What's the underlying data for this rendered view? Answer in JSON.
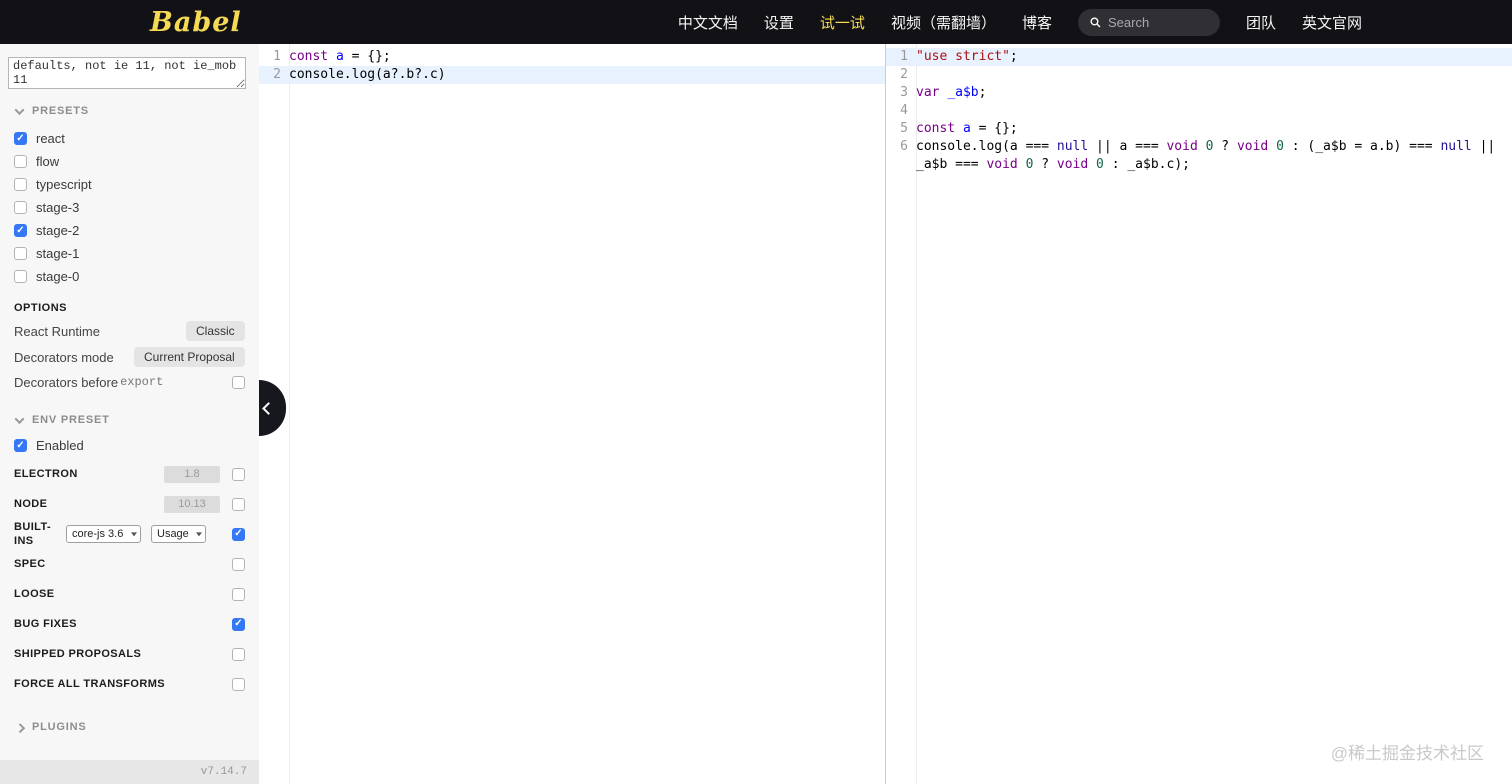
{
  "header": {
    "logo": "Babel",
    "nav": [
      {
        "label": "中文文档",
        "active": false
      },
      {
        "label": "设置",
        "active": false
      },
      {
        "label": "试一试",
        "active": true
      },
      {
        "label": "视频（需翻墙）",
        "active": false
      },
      {
        "label": "博客",
        "active": false
      }
    ],
    "search": {
      "placeholder": "Search"
    },
    "nav_right": [
      {
        "label": "团队"
      },
      {
        "label": "英文官网"
      }
    ]
  },
  "sidebar": {
    "browserslist_value": "defaults, not ie 11, not ie_mob 11",
    "presets": {
      "title": "PRESETS",
      "items": [
        {
          "label": "react",
          "checked": true
        },
        {
          "label": "flow",
          "checked": false
        },
        {
          "label": "typescript",
          "checked": false
        },
        {
          "label": "stage-3",
          "checked": false
        },
        {
          "label": "stage-2",
          "checked": true
        },
        {
          "label": "stage-1",
          "checked": false
        },
        {
          "label": "stage-0",
          "checked": false
        }
      ]
    },
    "options": {
      "title": "OPTIONS",
      "react_runtime_label": "React Runtime",
      "react_runtime_value": "Classic",
      "decorators_mode_label": "Decorators mode",
      "decorators_mode_value": "Current Proposal",
      "decorators_before_label": "Decorators before",
      "decorators_before_code": "export",
      "decorators_before_checked": false
    },
    "env": {
      "title": "ENV PRESET",
      "enabled_label": "Enabled",
      "enabled_checked": true,
      "electron_label": "ELECTRON",
      "electron_value": "1.8",
      "electron_checked": false,
      "node_label": "NODE",
      "node_value": "10.13",
      "node_checked": false,
      "builtins_label": "BUILT-INS",
      "builtins_select1": "core-js 3.6",
      "builtins_select2": "Usage",
      "builtins_checked": true,
      "toggles": [
        {
          "label": "SPEC",
          "checked": false
        },
        {
          "label": "LOOSE",
          "checked": false
        },
        {
          "label": "BUG FIXES",
          "checked": true
        },
        {
          "label": "SHIPPED PROPOSALS",
          "checked": false
        },
        {
          "label": "FORCE ALL TRANSFORMS",
          "checked": false
        }
      ]
    },
    "plugins_title": "PLUGINS",
    "version": "v7.14.7"
  },
  "editor_in": {
    "lines": [
      {
        "num": "1",
        "active": false,
        "tokens": [
          {
            "t": "const",
            "c": "keyword"
          },
          {
            "t": " "
          },
          {
            "t": "a",
            "c": "def"
          },
          {
            "t": " = {};"
          }
        ]
      },
      {
        "num": "2",
        "active": true,
        "tokens": [
          {
            "t": "console",
            "c": "variable"
          },
          {
            "t": ".log(a?.b?.c)"
          }
        ]
      }
    ]
  },
  "editor_out": {
    "lines": [
      {
        "num": "1",
        "active": true,
        "tokens": [
          {
            "t": "\"use strict\"",
            "c": "string"
          },
          {
            "t": ";"
          }
        ]
      },
      {
        "num": "2",
        "active": false,
        "tokens": []
      },
      {
        "num": "3",
        "active": false,
        "tokens": [
          {
            "t": "var",
            "c": "keyword"
          },
          {
            "t": " "
          },
          {
            "t": "_a$b",
            "c": "def"
          },
          {
            "t": ";"
          }
        ]
      },
      {
        "num": "4",
        "active": false,
        "tokens": []
      },
      {
        "num": "5",
        "active": false,
        "tokens": [
          {
            "t": "const",
            "c": "keyword"
          },
          {
            "t": " "
          },
          {
            "t": "a",
            "c": "def"
          },
          {
            "t": " = {};"
          }
        ]
      },
      {
        "num": "6",
        "active": false,
        "tokens": [
          {
            "t": "console",
            "c": "variable"
          },
          {
            "t": ".log(a === "
          },
          {
            "t": "null",
            "c": "atom"
          },
          {
            "t": " || a === "
          },
          {
            "t": "void",
            "c": "keyword"
          },
          {
            "t": " "
          },
          {
            "t": "0",
            "c": "number"
          },
          {
            "t": " ? "
          },
          {
            "t": "void",
            "c": "keyword"
          },
          {
            "t": " "
          },
          {
            "t": "0",
            "c": "number"
          },
          {
            "t": " : (_a$b = a.b) === "
          },
          {
            "t": "null",
            "c": "atom"
          },
          {
            "t": " || _a$b === "
          },
          {
            "t": "void",
            "c": "keyword"
          },
          {
            "t": " "
          },
          {
            "t": "0",
            "c": "number"
          },
          {
            "t": " ? "
          },
          {
            "t": "void",
            "c": "keyword"
          },
          {
            "t": " "
          },
          {
            "t": "0",
            "c": "number"
          },
          {
            "t": " : _a$b.c);"
          }
        ]
      }
    ]
  },
  "colors": {
    "accent_yellow": "#f5da55",
    "checkbox_blue": "#3478f6",
    "active_line": "#e8f2ff"
  },
  "watermark": "@稀土掘金技术社区"
}
